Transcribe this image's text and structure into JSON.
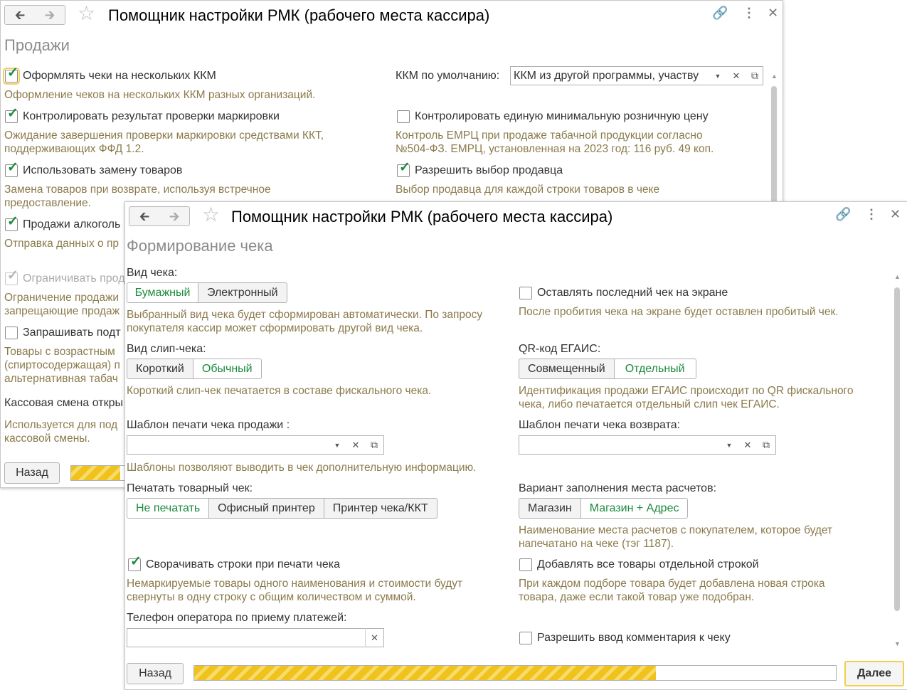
{
  "window1": {
    "title": "Помощник настройки РМК (рабочего места кассира)",
    "section": "Продажи",
    "multi_kkm": {
      "label": "Оформлять чеки на нескольких ККМ",
      "checked": true,
      "hint": "Оформление чеков на нескольких ККМ разных организаций."
    },
    "default_kkm": {
      "label": "ККМ по умолчанию:",
      "value": "ККМ из другой программы, участву"
    },
    "control_marking": {
      "label": "Контролировать результат проверки маркировки",
      "checked": true,
      "hint1": "Ожидание завершения проверки маркировки средствами ККТ,",
      "hint2": "поддерживающих ФФД 1.2."
    },
    "control_price": {
      "label": "Контролировать единую минимальную розничную цену",
      "checked": false,
      "hint1": "Контроль ЕМРЦ при продаже табачной продукции согласно",
      "hint2": "№504-ФЗ. ЕМРЦ, установленная на 2023 год: 116 руб. 49 коп."
    },
    "replace_goods": {
      "label": "Использовать замену товаров",
      "checked": true,
      "hint1": "Замена товаров при возврате, используя встречное",
      "hint2": "предоставление."
    },
    "select_seller": {
      "label": "Разрешить выбор продавца",
      "checked": true,
      "hint": "Выбор продавца для каждой строки товаров в чеке"
    },
    "alcohol": {
      "label": "Продажи алкоголь",
      "checked": true,
      "hint": "Отправка данных о пр"
    },
    "limit": {
      "label": "Ограничивать прод",
      "checked": true,
      "hint1": "Ограничение продажи",
      "hint2": "запрещающие продаж"
    },
    "ask": {
      "label": "Запрашивать подт",
      "checked": false,
      "hint1": "Товары с возрастным",
      "hint2": "(спиртосодержащая) п",
      "hint3": "альтернативная табач"
    },
    "shift": {
      "label": "Кассовая смена откры",
      "hint1": "Используется для под",
      "hint2": "кассовой смены."
    },
    "back_label": "Назад",
    "progress": 0.07
  },
  "window2": {
    "title": "Помощник настройки РМК (рабочего места кассира)",
    "section": "Формирование чека",
    "receipt_type": {
      "label": "Вид чека:",
      "options": [
        "Бумажный",
        "Электронный"
      ],
      "selected": 0,
      "hint1": "Выбранный вид чека будет сформирован автоматически. По запросу",
      "hint2": "покупателя кассир может сформировать другой вид чека."
    },
    "keep_last": {
      "label": "Оставлять последний чек на экране",
      "checked": false,
      "hint": "После пробития чека на экране будет оставлен пробитый чек."
    },
    "slip_type": {
      "label": "Вид слип-чека:",
      "options": [
        "Короткий",
        "Обычный"
      ],
      "selected": 1,
      "hint": "Короткий слип-чек печатается  в составе фискального чека."
    },
    "qr_egais": {
      "label": "QR-код ЕГАИС:",
      "options": [
        "Совмещенный",
        "Отдельный"
      ],
      "selected": 1,
      "hint1": "Идентификация продажи ЕГАИС происходит по QR фискального",
      "hint2": "чека, либо печатается отдельный слип чек ЕГАИС."
    },
    "sale_template": {
      "label": "Шаблон печати чека продажи :",
      "value": "",
      "hint": "Шаблоны позволяют выводить в чек дополнительную информацию."
    },
    "return_template": {
      "label": "Шаблон печати чека возврата:",
      "value": ""
    },
    "print_goods": {
      "label": "Печатать товарный чек:",
      "options": [
        "Не печатать",
        "Офисный принтер",
        "Принтер чека/ККТ"
      ],
      "selected": 0
    },
    "place_variant": {
      "label": "Вариант заполнения места расчетов:",
      "options": [
        "Магазин",
        "Магазин + Адрес"
      ],
      "selected": 1,
      "hint1": "Наименование места расчетов с покупателем, которое будет",
      "hint2": "напечатано на чеке (тэг 1187)."
    },
    "collapse": {
      "label": "Сворачивать строки при печати чека",
      "checked": true,
      "hint1": "Немаркируемые товары одного наименования и стоимости будут",
      "hint2": "свернуты в одну строку с общим количеством и суммой."
    },
    "add_separate": {
      "label": "Добавлять все товары отдельной строкой",
      "checked": false,
      "hint1": "При каждом подборе товара будет добавлена новая строка",
      "hint2": "товара, даже если такой товар уже подобран."
    },
    "phone": {
      "label": "Телефон оператора по приему платежей:",
      "value": ""
    },
    "comment": {
      "label": "Разрешить ввод комментария к чеку",
      "checked": false
    },
    "back_label": "Назад",
    "next_label": "Далее",
    "progress": 0.72
  }
}
